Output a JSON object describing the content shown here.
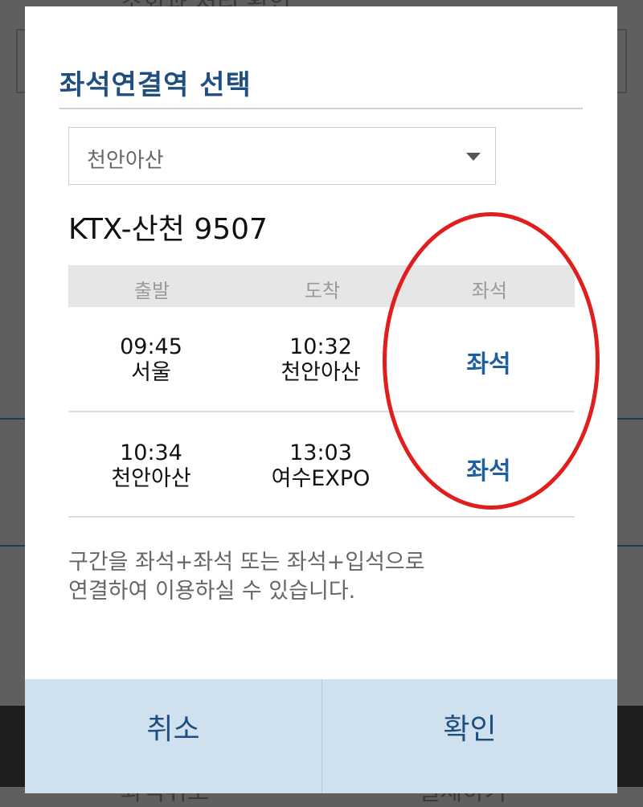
{
  "background": {
    "top_text": "조회과 처리 확인",
    "bottom_left_text": "좌석취소",
    "bottom_right_text": "결제하기"
  },
  "modal": {
    "title": "좌석연결역 선택",
    "station_select": {
      "value": "천안아산"
    },
    "train": "KTX-산천 9507",
    "columns": [
      "출발",
      "도착",
      "좌석"
    ],
    "rows": [
      {
        "dep_time": "09:45",
        "dep_station": "서울",
        "arr_time": "10:32",
        "arr_station": "천안아산",
        "seat": "좌석"
      },
      {
        "dep_time": "10:34",
        "dep_station": "천안아산",
        "arr_time": "13:03",
        "arr_station": "여수EXPO",
        "seat": "좌석"
      }
    ],
    "note_line1": "구간을 좌석+좌석 또는 좌석+입석으로",
    "note_line2": "연결하여 이용하실 수 있습니다.",
    "cancel_label": "취소",
    "confirm_label": "확인"
  },
  "colors": {
    "accent": "#1f4f7f",
    "seat_link": "#1e5fa0",
    "button_bg": "#cfe0ee",
    "annotation": "#e01e1e"
  }
}
